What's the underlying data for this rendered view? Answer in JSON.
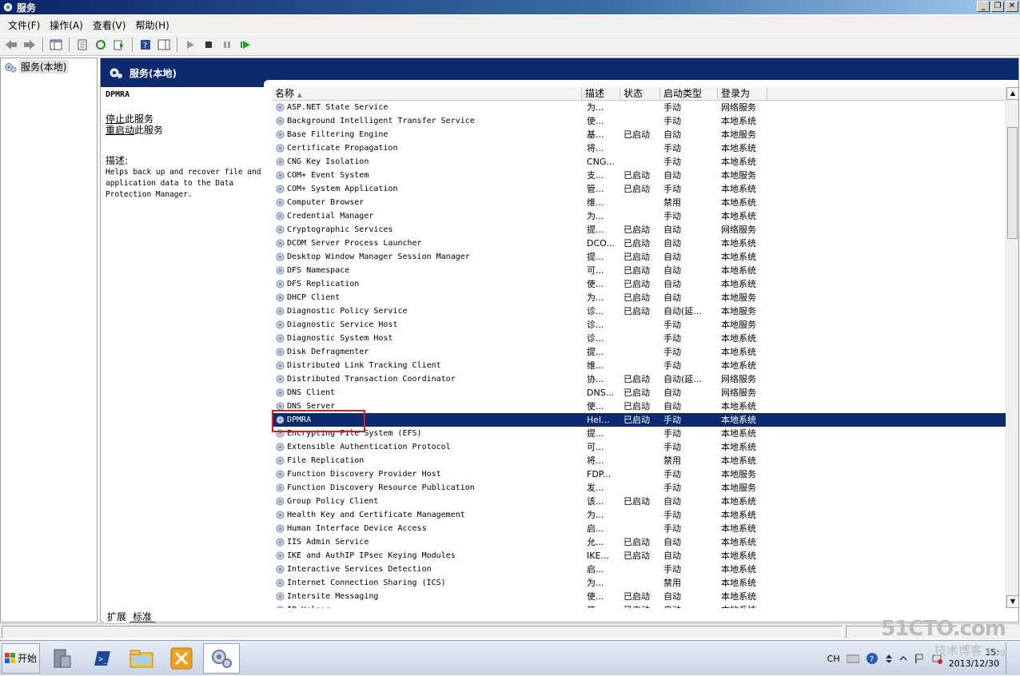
{
  "window": {
    "title": "服务"
  },
  "menu": [
    "文件(F)",
    "操作(A)",
    "查看(V)",
    "帮助(H)"
  ],
  "tree": {
    "root_label": "服务(本地)"
  },
  "main_header": {
    "title": "服务(本地)"
  },
  "detail": {
    "service_name": "DPMRA",
    "stop_link_underlined": "停止",
    "stop_link_rest": "此服务",
    "restart_link_underlined": "重启动",
    "restart_link_rest": "此服务",
    "desc_label": "描述:",
    "desc_text": "Helps back up and recover file and application data to the Data Protection Manager."
  },
  "columns": [
    "名称",
    "描述",
    "状态",
    "启动类型",
    "登录为"
  ],
  "rows": [
    {
      "name": "ASP.NET State Service",
      "desc": "为...",
      "state": "",
      "start": "手动",
      "logon": "网络服务"
    },
    {
      "name": "Background Intelligent Transfer Service",
      "desc": "使...",
      "state": "",
      "start": "手动",
      "logon": "本地系统"
    },
    {
      "name": "Base Filtering Engine",
      "desc": "基...",
      "state": "已启动",
      "start": "自动",
      "logon": "本地服务"
    },
    {
      "name": "Certificate Propagation",
      "desc": "将...",
      "state": "",
      "start": "手动",
      "logon": "本地系统"
    },
    {
      "name": "CNG Key Isolation",
      "desc": "CNG...",
      "state": "",
      "start": "手动",
      "logon": "本地系统"
    },
    {
      "name": "COM+ Event System",
      "desc": "支...",
      "state": "已启动",
      "start": "自动",
      "logon": "本地服务"
    },
    {
      "name": "COM+ System Application",
      "desc": "管...",
      "state": "已启动",
      "start": "手动",
      "logon": "本地系统"
    },
    {
      "name": "Computer Browser",
      "desc": "维...",
      "state": "",
      "start": "禁用",
      "logon": "本地系统"
    },
    {
      "name": "Credential Manager",
      "desc": "为...",
      "state": "",
      "start": "手动",
      "logon": "本地系统"
    },
    {
      "name": "Cryptographic Services",
      "desc": "提...",
      "state": "已启动",
      "start": "自动",
      "logon": "网络服务"
    },
    {
      "name": "DCOM Server Process Launcher",
      "desc": "DCO...",
      "state": "已启动",
      "start": "自动",
      "logon": "本地系统"
    },
    {
      "name": "Desktop Window Manager Session Manager",
      "desc": "提...",
      "state": "已启动",
      "start": "自动",
      "logon": "本地系统"
    },
    {
      "name": "DFS Namespace",
      "desc": "可...",
      "state": "已启动",
      "start": "自动",
      "logon": "本地系统"
    },
    {
      "name": "DFS Replication",
      "desc": "使...",
      "state": "已启动",
      "start": "自动",
      "logon": "本地系统"
    },
    {
      "name": "DHCP Client",
      "desc": "为...",
      "state": "已启动",
      "start": "自动",
      "logon": "本地服务"
    },
    {
      "name": "Diagnostic Policy Service",
      "desc": "诊...",
      "state": "已启动",
      "start": "自动(延...",
      "logon": "本地服务"
    },
    {
      "name": "Diagnostic Service Host",
      "desc": "诊...",
      "state": "",
      "start": "手动",
      "logon": "本地服务"
    },
    {
      "name": "Diagnostic System Host",
      "desc": "诊...",
      "state": "",
      "start": "手动",
      "logon": "本地系统"
    },
    {
      "name": "Disk Defragmenter",
      "desc": "提...",
      "state": "",
      "start": "手动",
      "logon": "本地系统"
    },
    {
      "name": "Distributed Link Tracking Client",
      "desc": "维...",
      "state": "",
      "start": "手动",
      "logon": "本地系统"
    },
    {
      "name": "Distributed Transaction Coordinator",
      "desc": "协...",
      "state": "已启动",
      "start": "自动(延...",
      "logon": "网络服务"
    },
    {
      "name": "DNS Client",
      "desc": "DNS...",
      "state": "已启动",
      "start": "自动",
      "logon": "网络服务"
    },
    {
      "name": "DNS Server",
      "desc": "使...",
      "state": "已启动",
      "start": "自动",
      "logon": "本地系统"
    },
    {
      "name": "DPMRA",
      "desc": "Hel...",
      "state": "已启动",
      "start": "手动",
      "logon": "本地系统",
      "selected": true
    },
    {
      "name": "Encrypting File System (EFS)",
      "desc": "提...",
      "state": "",
      "start": "手动",
      "logon": "本地系统"
    },
    {
      "name": "Extensible Authentication Protocol",
      "desc": "可...",
      "state": "",
      "start": "手动",
      "logon": "本地系统"
    },
    {
      "name": "File Replication",
      "desc": "将...",
      "state": "",
      "start": "禁用",
      "logon": "本地系统"
    },
    {
      "name": "Function Discovery Provider Host",
      "desc": "FDP...",
      "state": "",
      "start": "手动",
      "logon": "本地服务"
    },
    {
      "name": "Function Discovery Resource Publication",
      "desc": "发...",
      "state": "",
      "start": "手动",
      "logon": "本地服务"
    },
    {
      "name": "Group Policy Client",
      "desc": "该...",
      "state": "已启动",
      "start": "自动",
      "logon": "本地系统"
    },
    {
      "name": "Health Key and Certificate Management",
      "desc": "为...",
      "state": "",
      "start": "手动",
      "logon": "本地系统"
    },
    {
      "name": "Human Interface Device Access",
      "desc": "启...",
      "state": "",
      "start": "手动",
      "logon": "本地系统"
    },
    {
      "name": "IIS Admin Service",
      "desc": "允...",
      "state": "已启动",
      "start": "自动",
      "logon": "本地系统"
    },
    {
      "name": "IKE and AuthIP IPsec Keying Modules",
      "desc": "IKE...",
      "state": "已启动",
      "start": "自动",
      "logon": "本地系统"
    },
    {
      "name": "Interactive Services Detection",
      "desc": "启...",
      "state": "",
      "start": "手动",
      "logon": "本地系统"
    },
    {
      "name": "Internet Connection Sharing (ICS)",
      "desc": "为...",
      "state": "",
      "start": "禁用",
      "logon": "本地系统"
    },
    {
      "name": "Intersite Messaging",
      "desc": "使...",
      "state": "已启动",
      "start": "自动",
      "logon": "本地系统"
    },
    {
      "name": "IP Helper",
      "desc": "使...",
      "state": "已启动",
      "start": "自动",
      "logon": "本地系统"
    }
  ],
  "tabs": [
    "扩展",
    "标准"
  ],
  "taskbar": {
    "start_label": "开始"
  },
  "tray": {
    "lang": "CH",
    "time": "15:",
    "date": "2013/12/30"
  },
  "watermark": {
    "line1": "51CTO.com",
    "line2": "技术博客",
    "line3": "Blog"
  }
}
